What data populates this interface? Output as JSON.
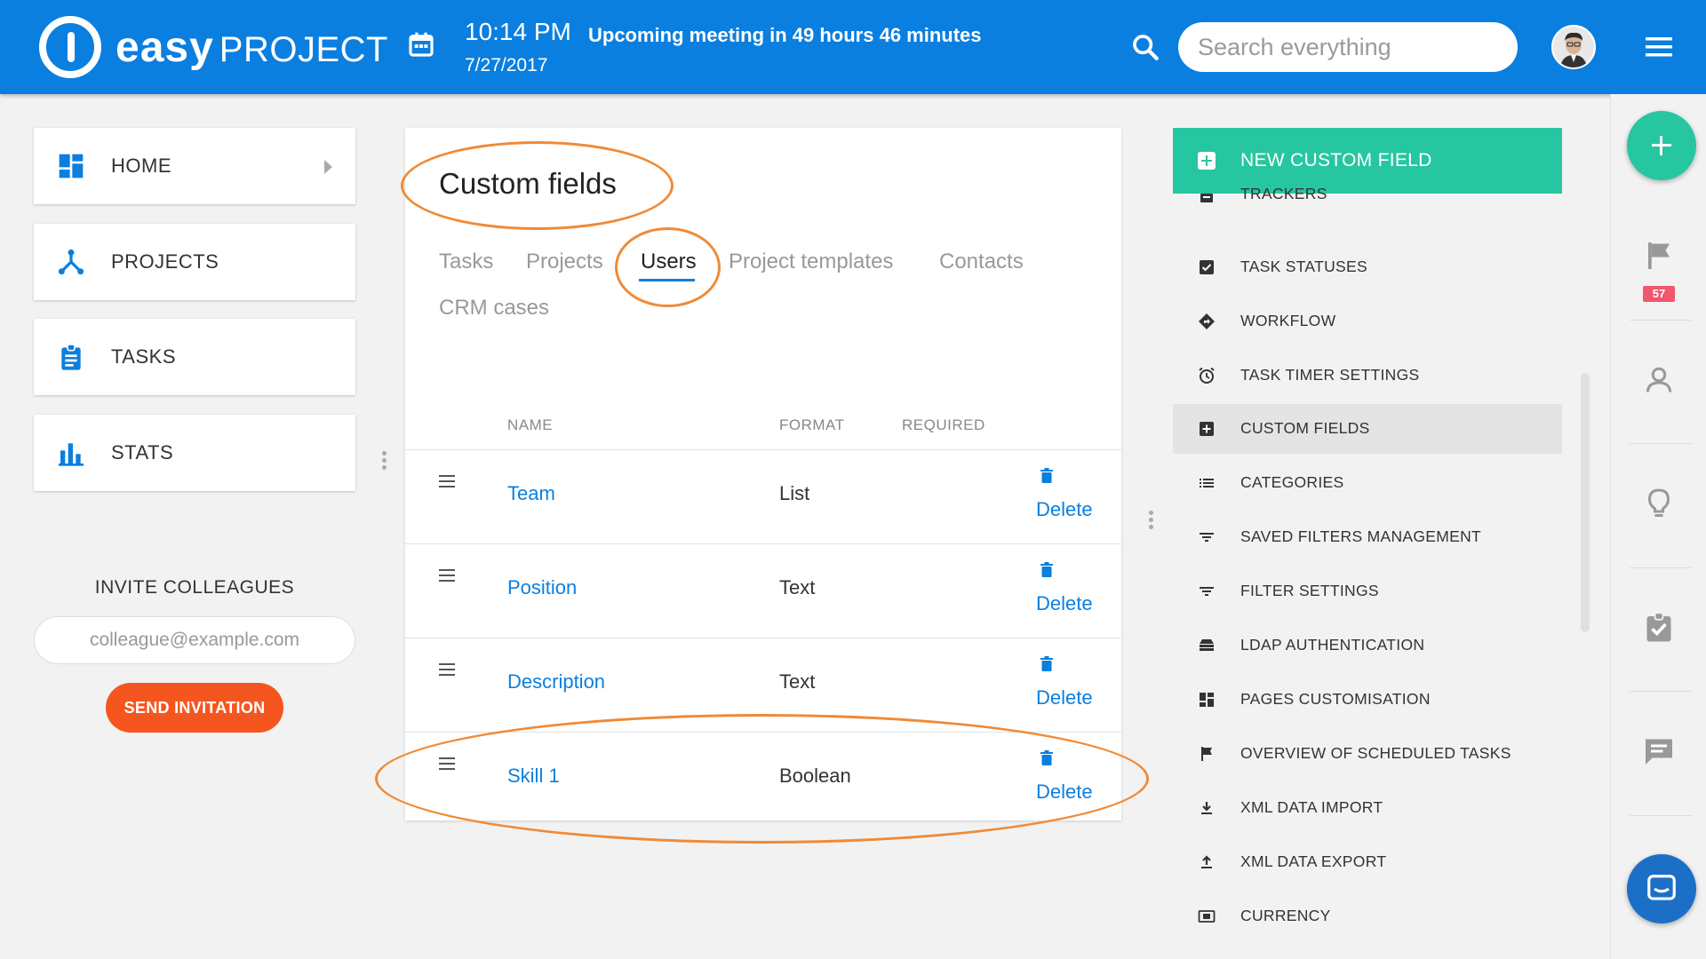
{
  "header": {
    "logo_bold": "easy",
    "logo_light": "PROJECT",
    "time": "10:14 PM",
    "date": "7/27/2017",
    "meeting": "Upcoming meeting in 49 hours 46 minutes",
    "search_placeholder": "Search everything",
    "accent_color": "#0a7fdf"
  },
  "nav": {
    "items": [
      {
        "label": "HOME",
        "icon": "dashboard-icon"
      },
      {
        "label": "PROJECTS",
        "icon": "projects-icon"
      },
      {
        "label": "TASKS",
        "icon": "clipboard-icon"
      },
      {
        "label": "STATS",
        "icon": "bar-chart-icon"
      }
    ]
  },
  "invite": {
    "title": "INVITE COLLEAGUES",
    "placeholder": "colleague@example.com",
    "button": "SEND INVITATION"
  },
  "main": {
    "title": "Custom fields",
    "tabs": [
      "Tasks",
      "Projects",
      "Users",
      "Project templates",
      "Contacts",
      "CRM cases"
    ],
    "active_tab": "Users",
    "columns": {
      "name": "NAME",
      "format": "FORMAT",
      "required": "REQUIRED"
    },
    "rows": [
      {
        "name": "Team",
        "format": "List",
        "action": "Delete"
      },
      {
        "name": "Position",
        "format": "Text",
        "action": "Delete"
      },
      {
        "name": "Description",
        "format": "Text",
        "action": "Delete"
      },
      {
        "name": "Skill 1",
        "format": "Boolean",
        "action": "Delete"
      }
    ]
  },
  "admin_menu": {
    "new_button": "NEW CUSTOM FIELD",
    "items": [
      {
        "label": "TRACKERS",
        "icon": "tracker-icon"
      },
      {
        "label": "TASK STATUSES",
        "icon": "checkbox-icon"
      },
      {
        "label": "WORKFLOW",
        "icon": "workflow-icon"
      },
      {
        "label": "TASK TIMER SETTINGS",
        "icon": "alarm-icon"
      },
      {
        "label": "CUSTOM FIELDS",
        "icon": "plus-box-icon",
        "active": true
      },
      {
        "label": "CATEGORIES",
        "icon": "list-icon"
      },
      {
        "label": "SAVED FILTERS MANAGEMENT",
        "icon": "filter-icon"
      },
      {
        "label": "FILTER SETTINGS",
        "icon": "filter-icon"
      },
      {
        "label": "LDAP AUTHENTICATION",
        "icon": "database-icon"
      },
      {
        "label": "PAGES CUSTOMISATION",
        "icon": "grid-icon"
      },
      {
        "label": "OVERVIEW OF SCHEDULED TASKS",
        "icon": "flag-icon"
      },
      {
        "label": "XML DATA IMPORT",
        "icon": "download-icon"
      },
      {
        "label": "XML DATA EXPORT",
        "icon": "upload-icon"
      },
      {
        "label": "CURRENCY",
        "icon": "currency-icon"
      }
    ]
  },
  "rail": {
    "flag_badge": "57"
  },
  "colors": {
    "primary": "#0a7fdf",
    "success": "#26c6a0",
    "orange": "#f5561f",
    "annotation": "#f08a36"
  }
}
